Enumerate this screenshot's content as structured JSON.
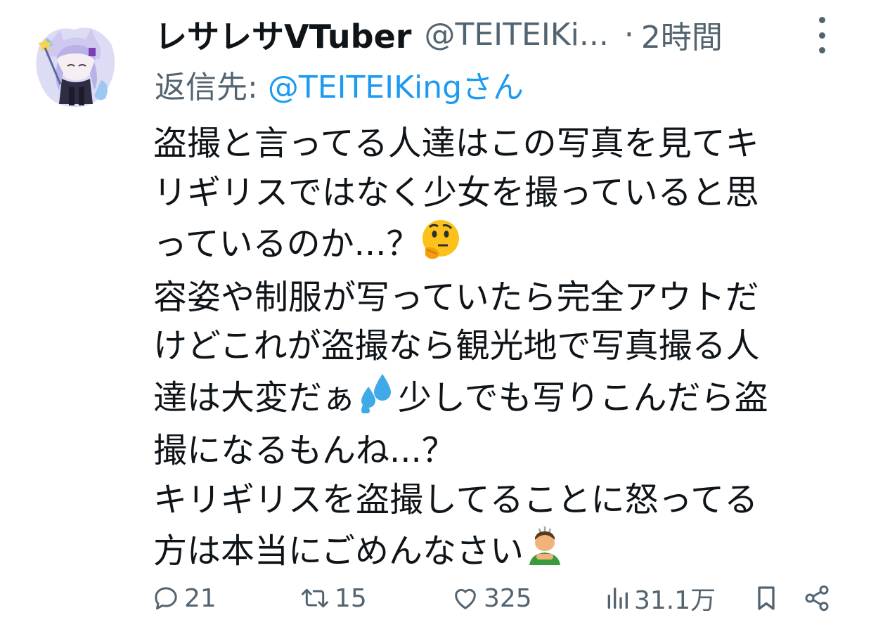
{
  "tweet": {
    "display_name": "レサレサVTuber",
    "handle": "@TEITEIKi...",
    "separator": "·",
    "time": "2時間",
    "reply_prefix": "返信先:",
    "reply_mention": "@TEITEIKing",
    "reply_suffix": "さん",
    "body_lines": [
      "盗撮と言ってる人達はこの写真を見てキ",
      "リギリスではなく少女を撮っていると思",
      "っているのか...？",
      "容姿や制服が写っていたら完全アウトだ",
      "けどこれが盗撮なら観光地で写真撮る人",
      "達は大変だぁ",
      "少しでも写りこんだら盗",
      "撮になるもんね...？",
      "キリギリスを盗撮してることに怒ってる",
      "方は本当にごめんなさい"
    ],
    "emojis": [
      "thinking-face",
      "sweat-droplets",
      "person-bowing"
    ]
  },
  "actions": {
    "replies": "21",
    "retweets": "15",
    "likes": "325",
    "views": "31.1万"
  },
  "colors": {
    "text": "#0f1419",
    "secondary": "#536471",
    "mention": "#1d9bf0"
  }
}
